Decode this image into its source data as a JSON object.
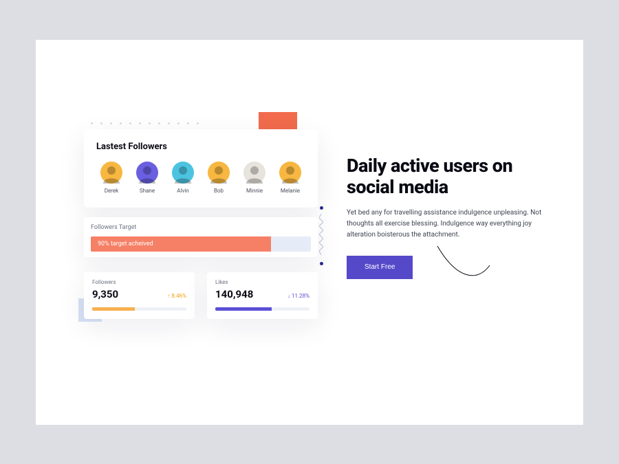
{
  "colors": {
    "accent_orange": "#f16b4c",
    "accent_purple": "#5649c9",
    "accent_amber": "#f7b151",
    "text_dark": "#0a0a14"
  },
  "followers_card": {
    "title": "Lastest Followers",
    "avatars": [
      {
        "name": "Derek",
        "bg": "#f7b740"
      },
      {
        "name": "Shane",
        "bg": "#6a5fe0"
      },
      {
        "name": "Alvin",
        "bg": "#4cc3e0"
      },
      {
        "name": "Bob",
        "bg": "#f7b740"
      },
      {
        "name": "Minnie",
        "bg": "#e7e3dd"
      },
      {
        "name": "Melanie",
        "bg": "#f7b740"
      }
    ]
  },
  "target": {
    "label": "Followers Target",
    "text": "90% target acheived",
    "percent": 82
  },
  "stats": {
    "followers": {
      "label": "Followers",
      "value": "9,350",
      "delta": "8.46%",
      "direction": "up",
      "bar_percent": 45
    },
    "likes": {
      "label": "Likes",
      "value": "140,948",
      "delta": "11.28%",
      "direction": "down",
      "bar_percent": 60
    }
  },
  "hero": {
    "title": "Daily active users on social media",
    "body": "Yet bed any for travelling assistance indulgence unpleasing. Not thoughts all exercise blessing. Indulgence way everything joy alteration boisterous the attachment.",
    "cta": "Start Free"
  }
}
